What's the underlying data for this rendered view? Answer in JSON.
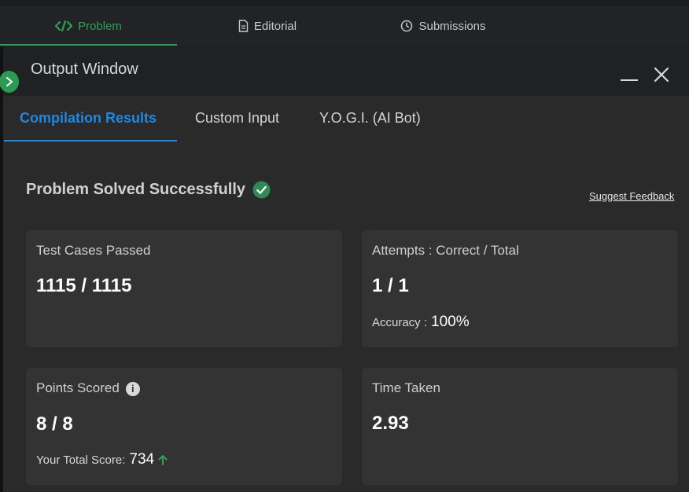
{
  "top_tabs": [
    {
      "label": "Problem",
      "icon": "code-icon",
      "active": true
    },
    {
      "label": "Editorial",
      "icon": "document-icon",
      "active": false
    },
    {
      "label": "Submissions",
      "icon": "clock-icon",
      "active": false
    }
  ],
  "output_window": {
    "title": "Output Window",
    "tabs": [
      {
        "label": "Compilation Results",
        "active": true
      },
      {
        "label": "Custom Input",
        "active": false
      },
      {
        "label": "Y.O.G.I. (AI Bot)",
        "active": false
      }
    ]
  },
  "result": {
    "status": "Problem Solved Successfully",
    "feedback_link": "Suggest Feedback"
  },
  "cards": {
    "test_cases": {
      "label": "Test Cases Passed",
      "value": "1115 / 1115"
    },
    "attempts": {
      "label": "Attempts : Correct / Total",
      "value": "1 / 1",
      "accuracy_label": "Accuracy :",
      "accuracy_value": "100%"
    },
    "points": {
      "label": "Points Scored",
      "value": "8 / 8",
      "total_label": "Your Total Score:",
      "total_value": "734"
    },
    "time": {
      "label": "Time Taken",
      "value": "2.93"
    }
  },
  "colors": {
    "accent_green": "#2fa05a",
    "accent_blue": "#1e88e5",
    "card_bg": "#333333",
    "success_check": "#2e8b57"
  }
}
